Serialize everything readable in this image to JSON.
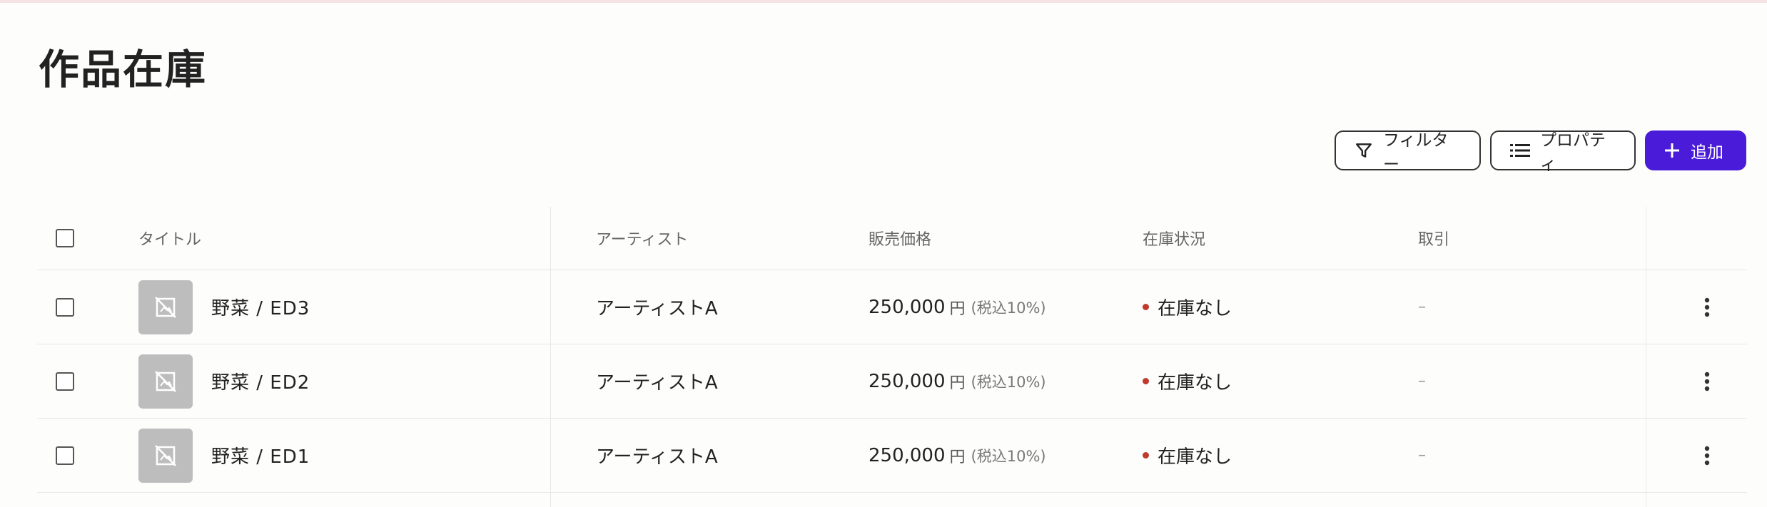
{
  "page": {
    "title": "作品在庫"
  },
  "toolbar": {
    "filter_label": "フィルター",
    "properties_label": "プロパティ",
    "add_label": "追加",
    "accent_color": "#4a1bd8"
  },
  "table": {
    "columns": {
      "title": "タイトル",
      "artist": "アーティスト",
      "price": "販売価格",
      "stock": "在庫状況",
      "deal": "取引"
    },
    "rows": [
      {
        "title": "野菜 / ED3",
        "artist": "アーティストA",
        "price": "250,000",
        "currency": "円",
        "tax": "(税込10%)",
        "stock": "在庫なし",
        "deal": "–"
      },
      {
        "title": "野菜 / ED2",
        "artist": "アーティストA",
        "price": "250,000",
        "currency": "円",
        "tax": "(税込10%)",
        "stock": "在庫なし",
        "deal": "–"
      },
      {
        "title": "野菜 / ED1",
        "artist": "アーティストA",
        "price": "250,000",
        "currency": "円",
        "tax": "(税込10%)",
        "stock": "在庫なし",
        "deal": "–"
      }
    ],
    "status_color": "#c0392b"
  }
}
